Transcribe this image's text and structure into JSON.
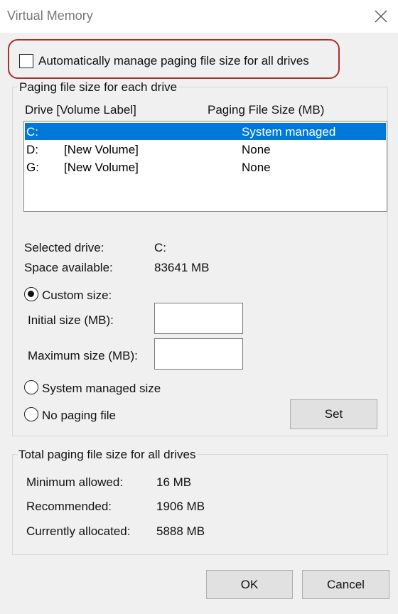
{
  "window": {
    "title": "Virtual Memory",
    "close_icon": "close-icon"
  },
  "auto_manage": {
    "label": "Automatically manage paging file size for all drives",
    "checked": false,
    "highlight_color": "#a83228"
  },
  "paging_group": {
    "title": "Paging file size for each drive",
    "columns": [
      "Drive  [Volume Label]",
      "Paging File Size (MB)"
    ],
    "drives": [
      {
        "drive": "C:",
        "label": "",
        "size": "System managed",
        "selected": true
      },
      {
        "drive": "D:",
        "label": "[New Volume]",
        "size": "None",
        "selected": false
      },
      {
        "drive": "G:",
        "label": "[New Volume]",
        "size": "None",
        "selected": false
      }
    ],
    "selected_drive_label": "Selected drive:",
    "selected_drive_value": "C:",
    "space_available_label": "Space available:",
    "space_available_value": "83641 MB",
    "custom_size_label": "Custom size:",
    "initial_size_label": "Initial size (MB):",
    "initial_size_value": "",
    "maximum_size_label": "Maximum size (MB):",
    "maximum_size_value": "",
    "system_managed_label": "System managed size",
    "no_paging_label": "No paging file",
    "selected_option": "custom",
    "set_button": "Set",
    "selection_color": "#0078d7"
  },
  "total_group": {
    "title": "Total paging file size for all drives",
    "minimum_label": "Minimum allowed:",
    "minimum_value": "16 MB",
    "recommended_label": "Recommended:",
    "recommended_value": "1906 MB",
    "allocated_label": "Currently allocated:",
    "allocated_value": "5888 MB"
  },
  "footer": {
    "ok_button": "OK",
    "cancel_button": "Cancel"
  }
}
